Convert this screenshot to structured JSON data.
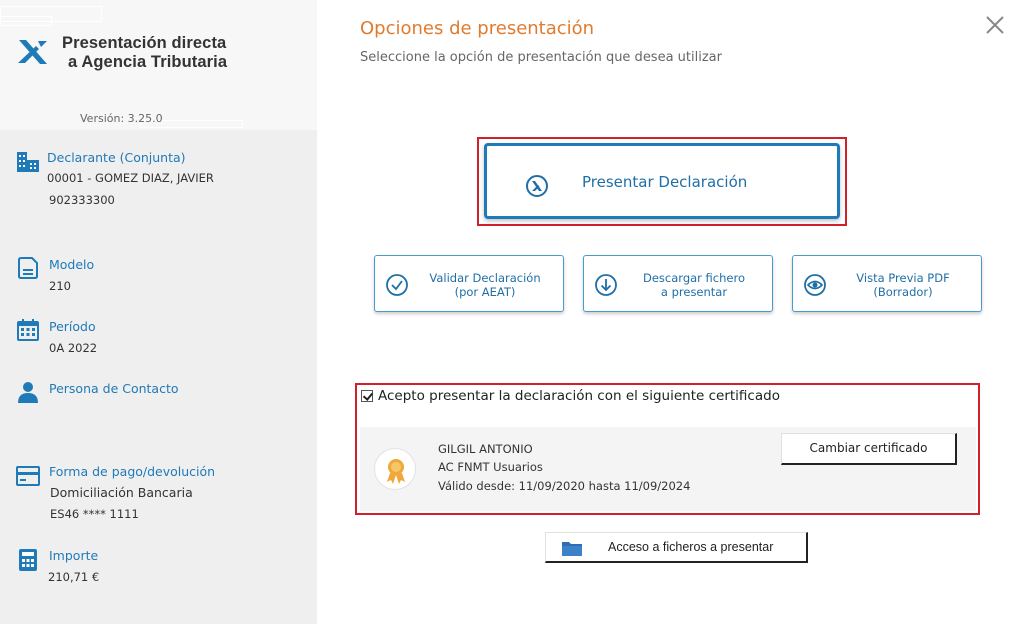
{
  "app": {
    "title_line1": "Presentación directa",
    "title_line2": "a Agencia Tributaria",
    "version": "Versión: 3.25.0"
  },
  "sidebar": {
    "declarante": {
      "label": "Declarante (Conjunta)",
      "name": "00001 - GOMEZ  DIAZ, JAVIER",
      "id": "902333300",
      "icon": "building-icon"
    },
    "modelo": {
      "label": "Modelo",
      "value": "210",
      "icon": "document-icon"
    },
    "periodo": {
      "label": "Período",
      "value": "0A 2022",
      "icon": "calendar-icon"
    },
    "contacto": {
      "label": "Persona de Contacto",
      "icon": "person-icon"
    },
    "pago": {
      "label": "Forma de pago/devolución",
      "method": "Domiciliación Bancaria",
      "iban": "ES46 **** 1111",
      "icon": "card-icon"
    },
    "importe": {
      "label": "Importe",
      "value": "210,71 €",
      "icon": "calculator-icon"
    }
  },
  "main": {
    "heading": "Opciones de presentación",
    "subheading": "Seleccione la opción de presentación que desea utilizar",
    "primary_button": "Presentar Declaración",
    "buttons": {
      "validar_l1": "Validar Declaración",
      "validar_l2": "(por AEAT)",
      "descargar_l1": "Descargar fichero",
      "descargar_l2": "a presentar",
      "vista_l1": "Vista Previa PDF",
      "vista_l2": "(Borrador)"
    },
    "accept_label": "Acepto presentar la declaración con el siguiente certificado",
    "accept_checked": true,
    "certificate": {
      "holder": "GILGIL ANTONIO",
      "issuer": "AC FNMT Usuarios",
      "validity": "Válido desde: 11/09/2020 hasta 11/09/2024"
    },
    "change_cert_button": "Cambiar certificado",
    "files_button": "Acceso a ficheros a presentar"
  },
  "colors": {
    "accent_blue": "#1f7ab8",
    "heading_orange": "#e07b2e",
    "highlight_red": "#d0202c"
  }
}
